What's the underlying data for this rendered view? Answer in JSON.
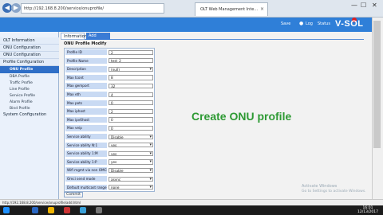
{
  "browser": {
    "address": "http://192.168.8.200/service/onuprofile/",
    "tab_title": "OLT Web Management Inte...",
    "tab_close": "×",
    "nav_back": "◀",
    "nav_forward": "▶",
    "win_min": "—",
    "win_max": "☐",
    "win_close": "✕",
    "status_url": "http://192.168.8.200/service/onuprofile/add.html"
  },
  "header": {
    "save": "Save",
    "log": "Log",
    "status": "Status",
    "logo": "V-SOL"
  },
  "sidebar": {
    "sections": [
      {
        "label": "OLT Information"
      },
      {
        "label": "ONU Configuration"
      },
      {
        "label": "ONU Configuration"
      },
      {
        "label": "Profile Configuration"
      }
    ],
    "sub_items": [
      {
        "label": "ONU Profile",
        "active": true
      },
      {
        "label": "DBA Profile"
      },
      {
        "label": "Traffic Profile"
      },
      {
        "label": "Line Profile"
      },
      {
        "label": "Service Profile"
      },
      {
        "label": "Alarm Profile"
      },
      {
        "label": "Bind Profile"
      }
    ],
    "system": "System Configuration"
  },
  "tabs": {
    "info": "Information",
    "add": "Add Profile"
  },
  "form": {
    "title": "ONU Profile Modify",
    "rows": [
      {
        "label": "Profile ID",
        "value": "2",
        "type": "input"
      },
      {
        "label": "Profile Name",
        "value": "test_2",
        "type": "input"
      },
      {
        "label": "Description",
        "value": "(null)",
        "type": "select"
      },
      {
        "label": "Max tcont",
        "value": "8",
        "type": "input"
      },
      {
        "label": "Max gemport",
        "value": "32",
        "type": "input"
      },
      {
        "label": "Max eth",
        "value": "4",
        "type": "input"
      },
      {
        "label": "Max pots",
        "value": "0",
        "type": "input"
      },
      {
        "label": "Max iphost",
        "value": "2",
        "type": "input"
      },
      {
        "label": "Max ipv6host",
        "value": "0",
        "type": "input"
      },
      {
        "label": "Max veip",
        "value": "0",
        "type": "input"
      },
      {
        "label": "Service ability",
        "value": "Disable",
        "type": "select"
      },
      {
        "label": "Service ability N:1",
        "value": "yes",
        "type": "select"
      },
      {
        "label": "Service ability 1:M",
        "value": "yes",
        "type": "select"
      },
      {
        "label": "Service ability 1:P",
        "value": "yes",
        "type": "select"
      },
      {
        "label": "Wifi mgmt via non OMCI",
        "value": "Disable",
        "type": "select"
      },
      {
        "label": "Omci send mode",
        "value": "async",
        "type": "select"
      },
      {
        "label": "Default multicast range",
        "value": "none",
        "type": "select"
      }
    ],
    "commit": "Commit"
  },
  "overlay_text": "Create ONU profile",
  "watermark": {
    "line1": "Activate Windows",
    "line2": "Go to Settings to activate Windows."
  },
  "taskbar": {
    "time": "16:01",
    "date": "12/13/2017"
  },
  "colors": {
    "header": "#2f7fd8",
    "active_item": "#2f6fc7",
    "overlay": "#2e9a34",
    "label_bg": "#c9daf3"
  }
}
